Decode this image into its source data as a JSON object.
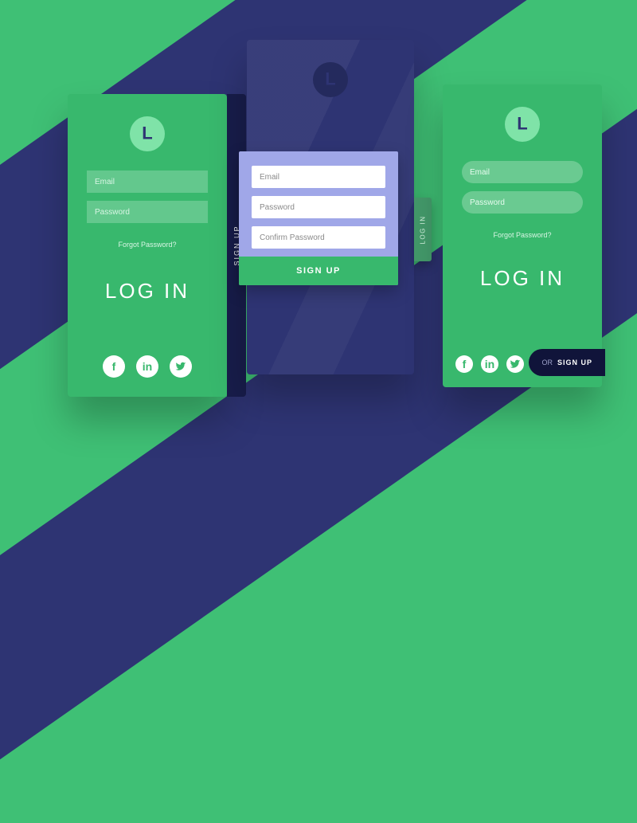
{
  "logo_letter": "L",
  "cardA": {
    "email_ph": "Email",
    "password_ph": "Password",
    "forgot": "Forgot Password?",
    "login": "LOG IN",
    "sidetab": "SIGN UP"
  },
  "cardB": {
    "email_ph": "Email",
    "password_ph": "Password",
    "confirm_ph": "Confirm Password",
    "signup": "SIGN UP",
    "sideflap": "LOG IN"
  },
  "cardC": {
    "email_ph": "Email",
    "password_ph": "Password",
    "forgot": "Forgot Password?",
    "login": "LOG IN",
    "or": "OR",
    "signup": "SIGN UP"
  },
  "social": {
    "facebook": "f",
    "linkedin": "in"
  }
}
